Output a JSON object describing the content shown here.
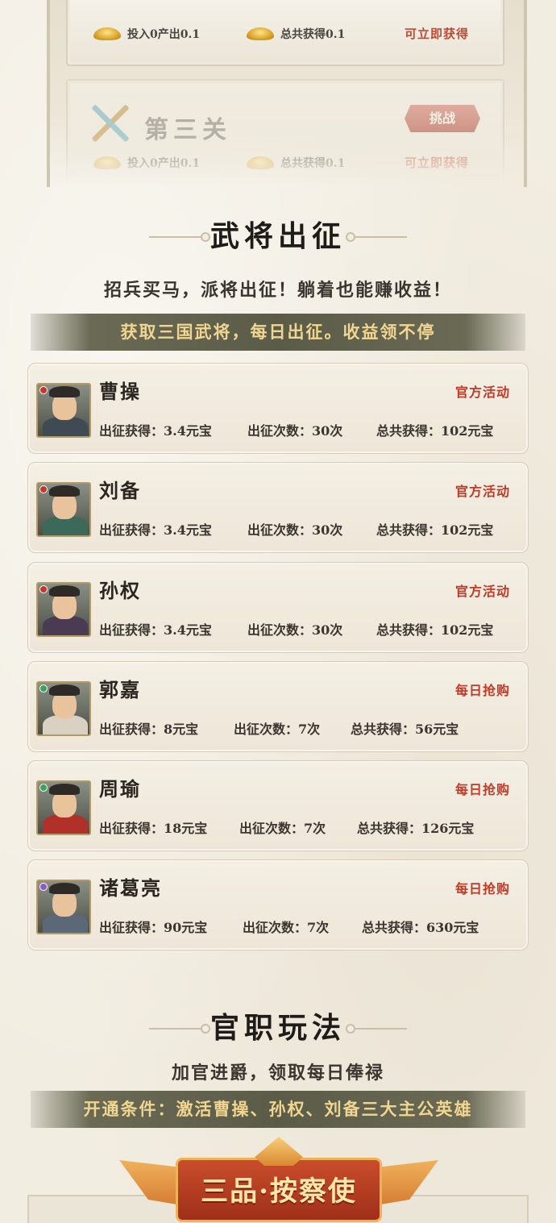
{
  "stages": [
    {
      "invest_text": "投入0产出0.1",
      "total_text": "总共获得0.1",
      "claim_text": "可立即获得"
    },
    {
      "title": "第三关",
      "challenge_label": "挑战",
      "invest_text": "投入0产出0.1",
      "total_text": "总共获得0.1",
      "claim_text": "可立即获得"
    }
  ],
  "generals_section": {
    "title": "武将出征",
    "subtitle": "招兵买马，派将出征！躺着也能赚收益！",
    "banner": "获取三国武将，每日出征。收益领不停",
    "generals": [
      {
        "name": "曹操",
        "tag": "官方活动",
        "gain": "出征获得：3.4元宝",
        "times": "出征次数：30次",
        "total": "总共获得：102元宝",
        "robe_color": "#3f4a52",
        "gem_color": "#c8352a"
      },
      {
        "name": "刘备",
        "tag": "官方活动",
        "gain": "出征获得：3.4元宝",
        "times": "出征次数：30次",
        "total": "总共获得：102元宝",
        "robe_color": "#3c6a5a",
        "gem_color": "#c8352a"
      },
      {
        "name": "孙权",
        "tag": "官方活动",
        "gain": "出征获得：3.4元宝",
        "times": "出征次数：30次",
        "total": "总共获得：102元宝",
        "robe_color": "#4a3a52",
        "gem_color": "#c8352a"
      },
      {
        "name": "郭嘉",
        "tag": "每日抢购",
        "gain": "出征获得：8元宝",
        "times": "出征次数：7次",
        "total": "总共获得：56元宝",
        "robe_color": "#d9d2c2",
        "gem_color": "#3aa35a"
      },
      {
        "name": "周瑜",
        "tag": "每日抢购",
        "gain": "出征获得：18元宝",
        "times": "出征次数：7次",
        "total": "总共获得：126元宝",
        "robe_color": "#b0302a",
        "gem_color": "#3aa35a"
      },
      {
        "name": "诸葛亮",
        "tag": "每日抢购",
        "gain": "出征获得：90元宝",
        "times": "出征次数：7次",
        "total": "总共获得：630元宝",
        "robe_color": "#5a6878",
        "gem_color": "#8a5ac8"
      }
    ]
  },
  "official_section": {
    "title": "官职玩法",
    "subtitle": "加官进爵，领取每日俸禄",
    "banner": "开通条件：激活曹操、孙权、刘备三大主公英雄",
    "rank_title": "三品·按察使"
  }
}
